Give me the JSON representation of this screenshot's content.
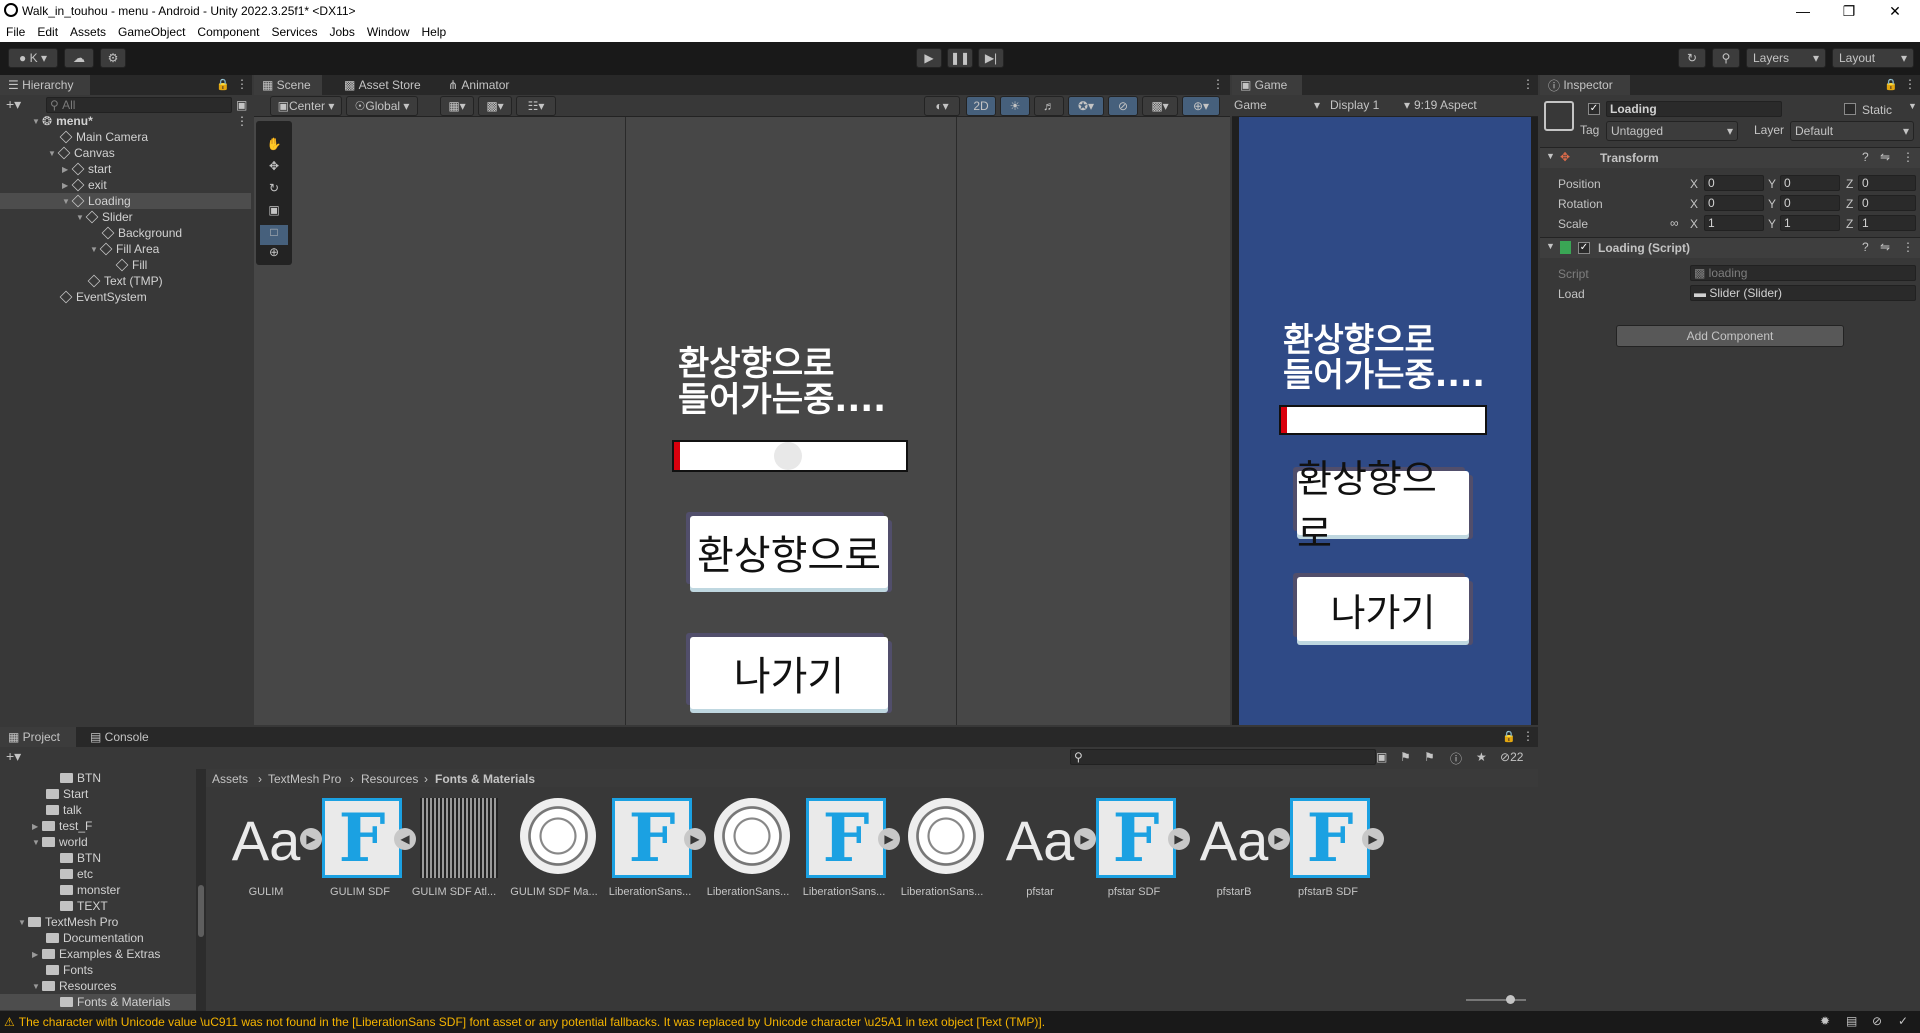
{
  "window": {
    "title": "Walk_in_touhou - menu - Android - Unity 2022.3.25f1* <DX11>"
  },
  "menu": [
    "File",
    "Edit",
    "Assets",
    "GameObject",
    "Component",
    "Services",
    "Jobs",
    "Window",
    "Help"
  ],
  "toolbar": {
    "account": "K",
    "layers": "Layers",
    "layout": "Layout"
  },
  "hierarchy": {
    "tab": "Hierarchy",
    "search_placeholder": "All",
    "items": [
      {
        "label": "menu*",
        "depth": 0
      },
      {
        "label": "Main Camera",
        "depth": 1
      },
      {
        "label": "Canvas",
        "depth": 1
      },
      {
        "label": "start",
        "depth": 2
      },
      {
        "label": "exit",
        "depth": 2
      },
      {
        "label": "Loading",
        "depth": 2
      },
      {
        "label": "Slider",
        "depth": 3
      },
      {
        "label": "Background",
        "depth": 4
      },
      {
        "label": "Fill Area",
        "depth": 4
      },
      {
        "label": "Fill",
        "depth": 5
      },
      {
        "label": "Text (TMP)",
        "depth": 3
      },
      {
        "label": "EventSystem",
        "depth": 1
      }
    ]
  },
  "scene": {
    "tabs": [
      "Scene",
      "Asset Store",
      "Animator"
    ],
    "pivot": "Center",
    "space": "Global",
    "mode_2d": "2D",
    "loading_text_line1": "환상향으로",
    "loading_text_line2": "들어가는중....",
    "start_label": "환상향으로",
    "exit_label": "나가기"
  },
  "game": {
    "tab": "Game",
    "mode": "Game",
    "display": "Display 1",
    "aspect": "9:19 Aspect",
    "loading_text_line1": "환상향으로",
    "loading_text_line2": "들어가는중....",
    "start_label": "환상향으로",
    "exit_label": "나가기",
    "background_color": "#2f4a86"
  },
  "inspector": {
    "tab": "Inspector",
    "object_name": "Loading",
    "static_label": "Static",
    "tag_label": "Tag",
    "tag_value": "Untagged",
    "layer_label": "Layer",
    "layer_value": "Default",
    "transform": {
      "title": "Transform",
      "position_label": "Position",
      "rotation_label": "Rotation",
      "scale_label": "Scale",
      "position": [
        "0",
        "0",
        "0"
      ],
      "rotation": [
        "0",
        "0",
        "0"
      ],
      "scale": [
        "1",
        "1",
        "1"
      ]
    },
    "script_component": {
      "title": "Loading (Script)",
      "script_label": "Script",
      "script_value": "loading",
      "load_label": "Load",
      "load_value": "Slider (Slider)"
    },
    "add_component": "Add Component"
  },
  "project": {
    "tabs": [
      "Project",
      "Console"
    ],
    "tree": [
      {
        "label": "BTN",
        "indent": 2
      },
      {
        "label": "Start",
        "indent": 1
      },
      {
        "label": "talk",
        "indent": 1
      },
      {
        "label": "test_F",
        "indent": 1
      },
      {
        "label": "world",
        "indent": 1
      },
      {
        "label": "BTN",
        "indent": 2
      },
      {
        "label": "etc",
        "indent": 2
      },
      {
        "label": "monster",
        "indent": 2
      },
      {
        "label": "TEXT",
        "indent": 2
      },
      {
        "label": "TextMesh Pro",
        "indent": 0
      },
      {
        "label": "Documentation",
        "indent": 1
      },
      {
        "label": "Examples & Extras",
        "indent": 1
      },
      {
        "label": "Fonts",
        "indent": 1
      },
      {
        "label": "Resources",
        "indent": 1
      },
      {
        "label": "Fonts & Materials",
        "indent": 2
      }
    ],
    "breadcrumb": [
      "Assets",
      "TextMesh Pro",
      "Resources",
      "Fonts & Materials"
    ],
    "hidden_count": "22",
    "assets": [
      {
        "label": "GULIM",
        "kind": "font"
      },
      {
        "label": "GULIM SDF",
        "kind": "sdf"
      },
      {
        "label": "GULIM SDF Atl...",
        "kind": "atlas"
      },
      {
        "label": "GULIM SDF Ma...",
        "kind": "material"
      },
      {
        "label": "LiberationSans...",
        "kind": "sdf"
      },
      {
        "label": "LiberationSans...",
        "kind": "material"
      },
      {
        "label": "LiberationSans...",
        "kind": "sdf"
      },
      {
        "label": "LiberationSans...",
        "kind": "material"
      },
      {
        "label": "pfstar",
        "kind": "font"
      },
      {
        "label": "pfstar SDF",
        "kind": "sdf"
      },
      {
        "label": "pfstarB",
        "kind": "font"
      },
      {
        "label": "pfstarB SDF",
        "kind": "sdf"
      }
    ]
  },
  "status": {
    "message": "The character with Unicode value \\uC911 was not found in the [LiberationSans SDF] font asset or any potential fallbacks. It was replaced by Unicode character \\u25A1 in text object [Text (TMP)]."
  }
}
